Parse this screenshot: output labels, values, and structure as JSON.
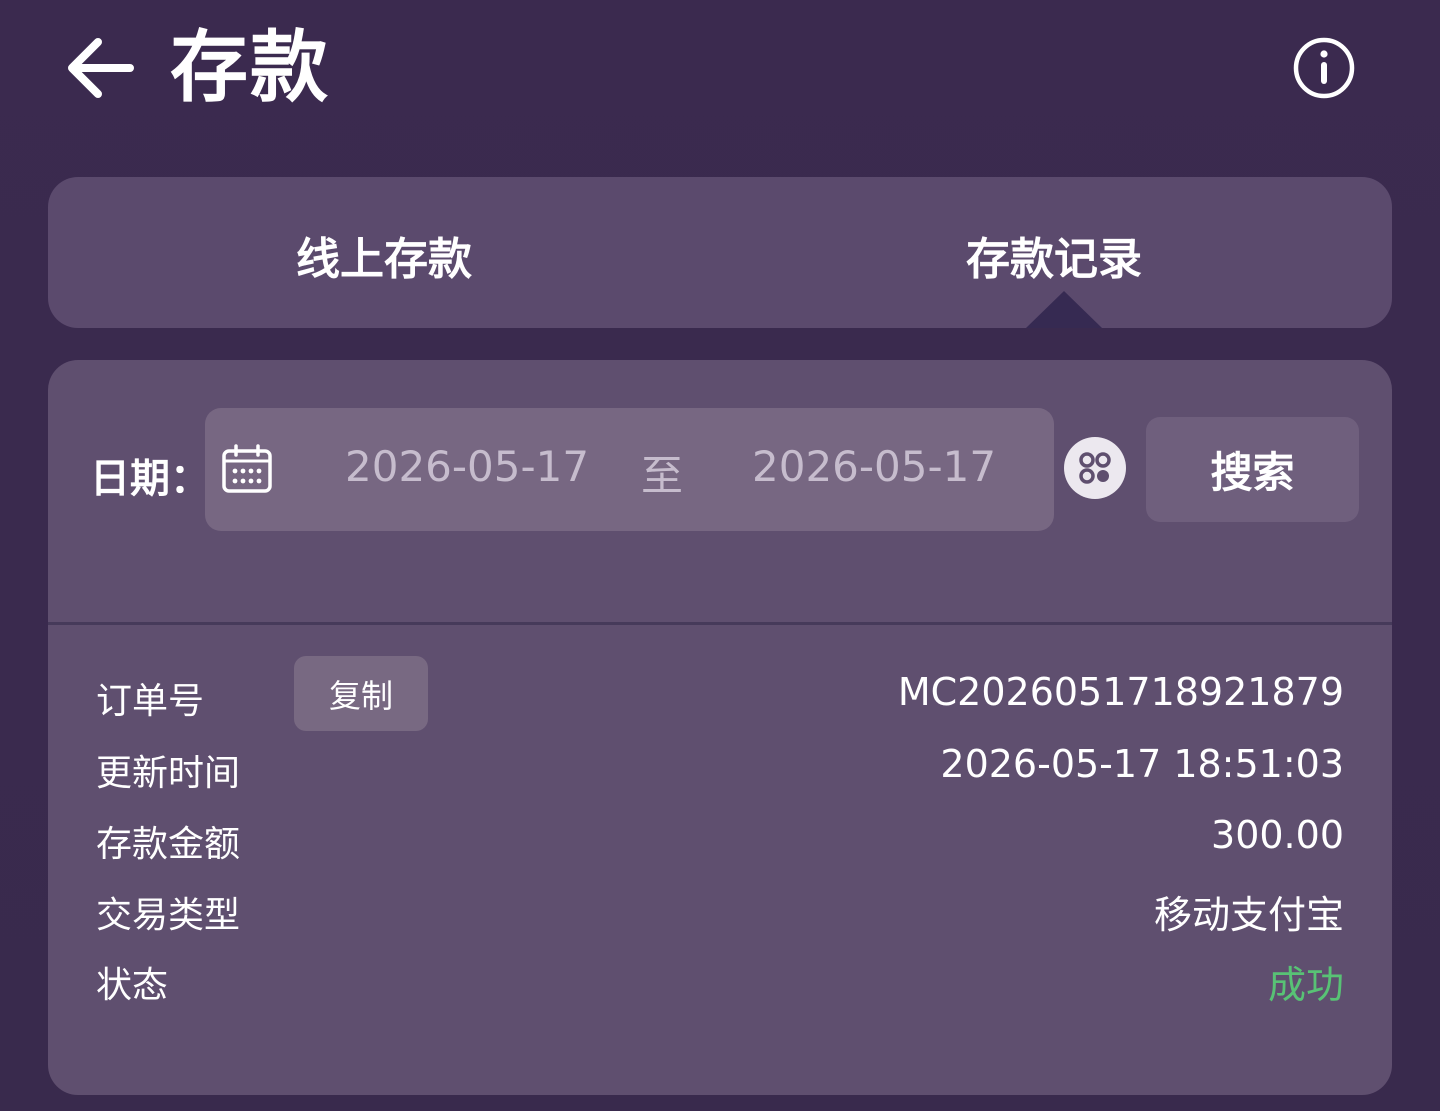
{
  "header": {
    "title": "存款",
    "back_icon": "arrow-left-icon",
    "info_icon": "info-circle-icon"
  },
  "tabs": [
    {
      "label": "线上存款",
      "active": false
    },
    {
      "label": "存款记录",
      "active": true
    }
  ],
  "filter": {
    "date_label": "日期：",
    "start_date": "2026-05-17",
    "separator": "至",
    "end_date": "2026-05-17",
    "calendar_icon": "calendar-icon",
    "clear_icon": "clear-dates-icon",
    "search_label": "搜索"
  },
  "record": {
    "copy_label": "复制",
    "fields": [
      {
        "label": "订单号",
        "value": "MC2026051718921879"
      },
      {
        "label": "更新时间",
        "value": "2026-05-17 18:51:03"
      },
      {
        "label": "存款金额",
        "value": "300.00"
      },
      {
        "label": "交易类型",
        "value": "移动支付宝"
      },
      {
        "label": "状态",
        "value": "成功"
      }
    ]
  },
  "colors": {
    "background": "#3b2a4f",
    "card": "#5f4f6f",
    "success": "#58c275"
  }
}
